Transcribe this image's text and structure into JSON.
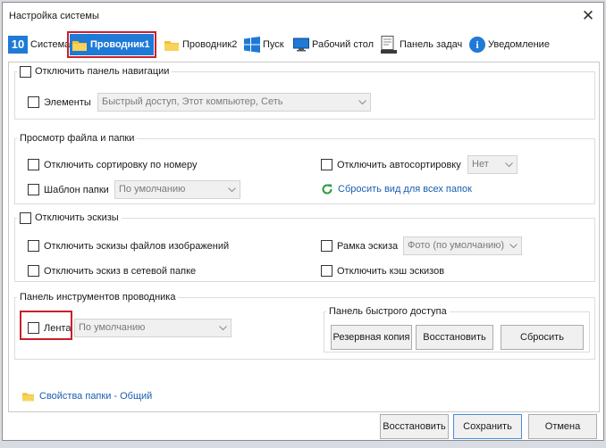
{
  "window": {
    "title": "Настройка системы"
  },
  "tabs": [
    {
      "label": "Система",
      "icon": "windows10-icon"
    },
    {
      "label": "Проводник1",
      "icon": "folder-icon",
      "active": true
    },
    {
      "label": "Проводник2",
      "icon": "folder-icon"
    },
    {
      "label": "Пуск",
      "icon": "windows-logo-icon"
    },
    {
      "label": "Рабочий стол",
      "icon": "desktop-icon"
    },
    {
      "label": "Панель задач",
      "icon": "taskbar-icon"
    },
    {
      "label": "Уведомление",
      "icon": "info-icon"
    }
  ],
  "navpane": {
    "legend": "Отключить панель навигации",
    "elements_label": "Элементы",
    "elements_value": "Быстрый доступ, Этот компьютер, Сеть"
  },
  "fileview": {
    "legend": "Просмотр файла и папки",
    "sort_numeric": "Отключить сортировку по номеру",
    "auto_sort": "Отключить автосортировку",
    "auto_sort_value": "Нет",
    "folder_template": "Шаблон папки",
    "folder_template_value": "По умолчанию",
    "reset_view": "Сбросить вид для всех папок"
  },
  "thumbs": {
    "legend": "Отключить эскизы",
    "image_thumbs": "Отключить эскизы файлов изображений",
    "frame": "Рамка эскиза",
    "frame_value": "Фото (по умолчанию)",
    "network_thumbs": "Отключить эскиз в сетевой папке",
    "thumb_cache": "Отключить кэш эскизов"
  },
  "toolbar": {
    "legend": "Панель инструментов проводника",
    "ribbon": "Лента",
    "ribbon_value": "По умолчанию",
    "quick_access_legend": "Панель быстрого доступа",
    "backup": "Резервная копия",
    "restore": "Восстановить",
    "reset": "Сбросить"
  },
  "footer": {
    "folder_props": "Свойства папки - Общий",
    "restore": "Восстановить",
    "save": "Сохранить",
    "cancel": "Отмена"
  },
  "colors": {
    "accent": "#1e7ad6",
    "highlight": "#c8202a",
    "link": "#1a5fb0",
    "folder": "#f2c12e"
  }
}
